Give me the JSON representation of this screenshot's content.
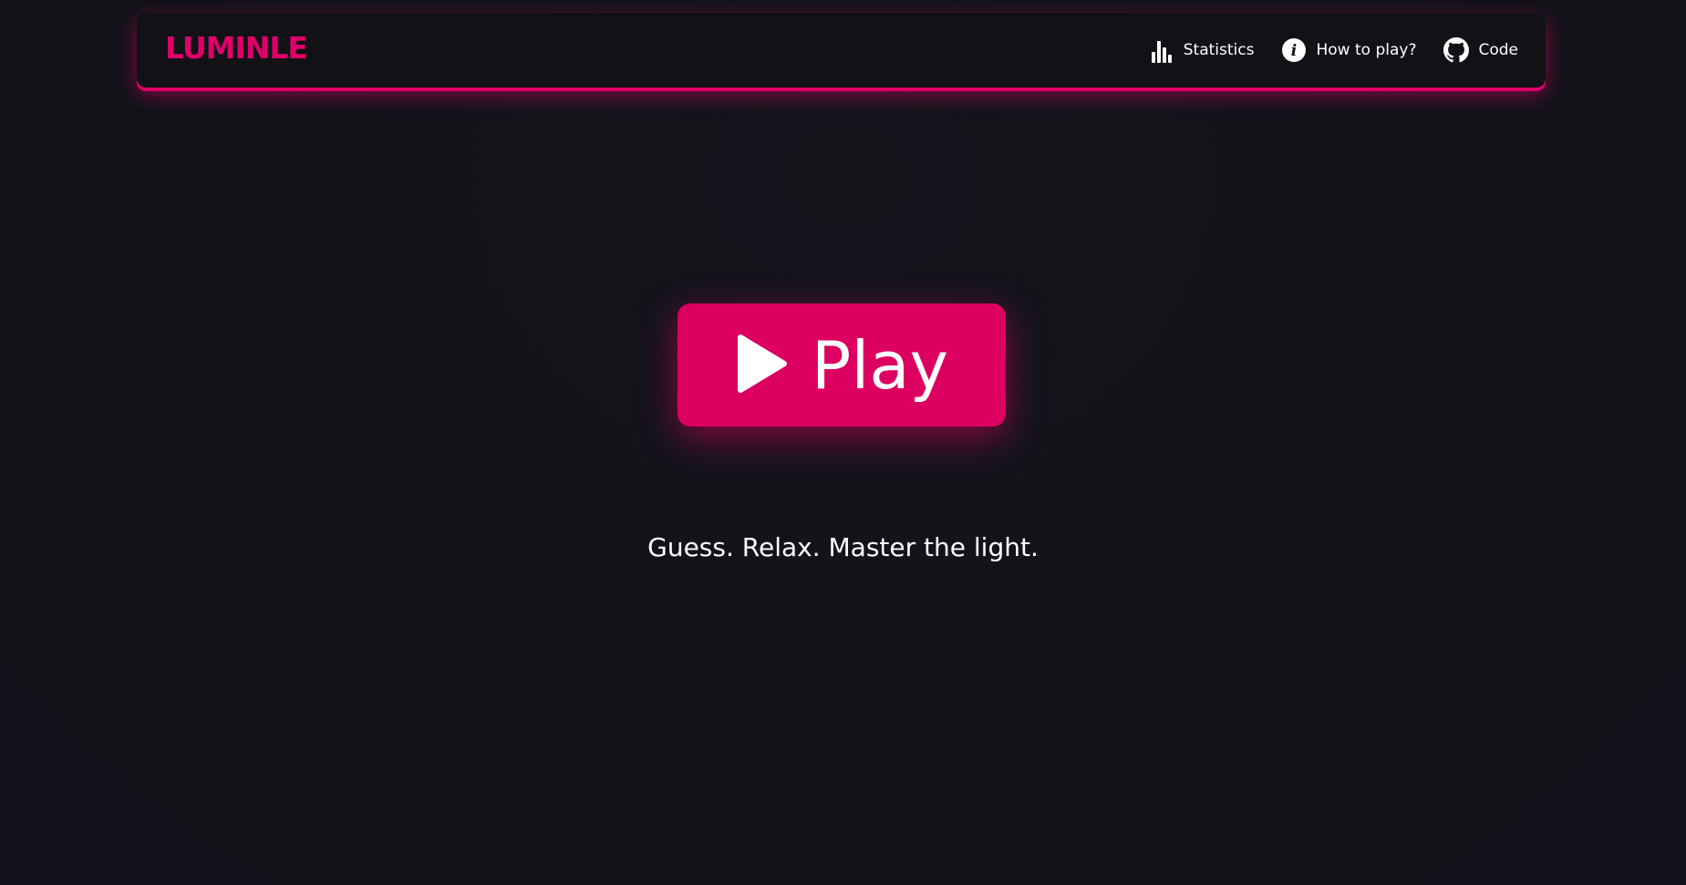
{
  "header": {
    "logo": "LUMINLE",
    "nav": [
      {
        "label": "Statistics",
        "icon": "bar-chart-icon"
      },
      {
        "label": "How to play?",
        "icon": "info-icon"
      },
      {
        "label": "Code",
        "icon": "github-icon"
      }
    ]
  },
  "main": {
    "play_label": "Play",
    "play_icon": "play-icon",
    "tagline": "Guess. Relax. Master the light."
  },
  "colors": {
    "accent": "#dc0060",
    "background": "#121218",
    "header_background": "#111116",
    "text": "#ffffff"
  }
}
